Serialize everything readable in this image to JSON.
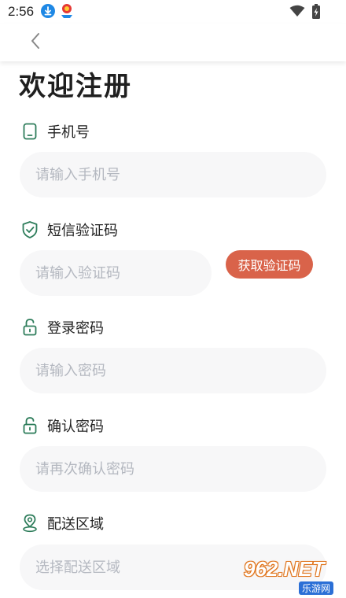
{
  "status_bar": {
    "time": "2:56",
    "icons": [
      "download-icon",
      "app-notification-icon",
      "wifi-icon",
      "battery-icon"
    ]
  },
  "header": {
    "back_icon": "chevron-left-icon"
  },
  "page": {
    "title": "欢迎注册"
  },
  "form": {
    "phone": {
      "label": "手机号",
      "icon": "phone-icon",
      "placeholder": "请输入手机号"
    },
    "sms_code": {
      "label": "短信验证码",
      "icon": "shield-check-icon",
      "placeholder": "请输入验证码",
      "button_label": "获取验证码"
    },
    "password": {
      "label": "登录密码",
      "icon": "lock-icon",
      "placeholder": "请输入密码"
    },
    "confirm_password": {
      "label": "确认密码",
      "icon": "lock-icon",
      "placeholder": "请再次确认密码"
    },
    "delivery_area": {
      "label": "配送区域",
      "icon": "location-pin-icon",
      "placeholder": "选择配送区域"
    }
  },
  "colors": {
    "icon_green": "#2e7d5b",
    "button_orange": "#d9634a",
    "input_bg": "#f7f7f8",
    "placeholder": "#b4b8c0"
  },
  "watermark": {
    "text": "962.NET",
    "sub": "乐游网"
  }
}
